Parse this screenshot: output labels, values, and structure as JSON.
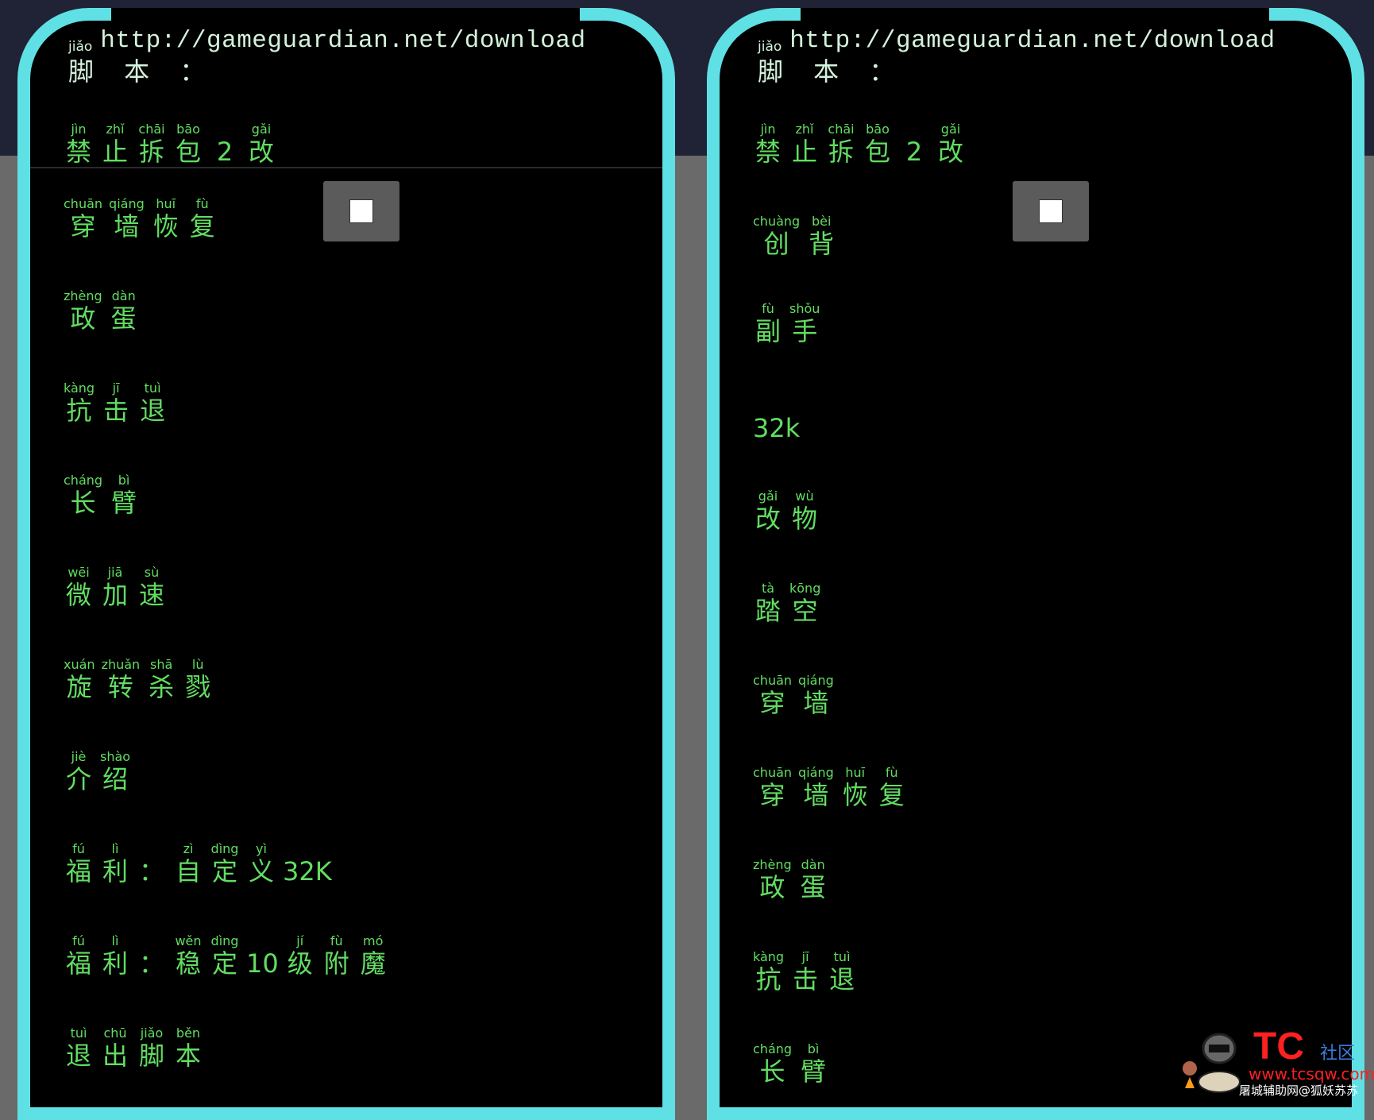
{
  "colors": {
    "accent_cyan": "#5fe0e4",
    "menu_text": "#62dd62",
    "header_text": "#d4f2dc",
    "top_bg": "#1f2335",
    "bottom_bg": "#6a6a6a"
  },
  "panels": [
    {
      "header": {
        "pinyin": "jiǎo",
        "url": "http://gameguardian.net/download",
        "title": "脚 本 ："
      },
      "toggle_checked": false,
      "items": [
        [
          {
            "py": "jìn",
            "ch": "禁"
          },
          {
            "py": "zhǐ",
            "ch": "止"
          },
          {
            "py": "chāi",
            "ch": "拆"
          },
          {
            "py": "bāo",
            "ch": "包"
          },
          {
            "py": "",
            "ch": "2"
          },
          {
            "py": "gǎi",
            "ch": "改"
          }
        ],
        [
          {
            "py": "chuān",
            "ch": "穿"
          },
          {
            "py": "qiáng",
            "ch": "墙"
          },
          {
            "py": "huī",
            "ch": "恢"
          },
          {
            "py": "fù",
            "ch": "复"
          }
        ],
        [
          {
            "py": "zhèng",
            "ch": "政"
          },
          {
            "py": "dàn",
            "ch": "蛋"
          }
        ],
        [
          {
            "py": "kàng",
            "ch": "抗"
          },
          {
            "py": "jī",
            "ch": "击"
          },
          {
            "py": "tuì",
            "ch": "退"
          }
        ],
        [
          {
            "py": "cháng",
            "ch": "长"
          },
          {
            "py": "bì",
            "ch": "臂"
          }
        ],
        [
          {
            "py": "wēi",
            "ch": "微"
          },
          {
            "py": "jiā",
            "ch": "加"
          },
          {
            "py": "sù",
            "ch": "速"
          }
        ],
        [
          {
            "py": "xuán",
            "ch": "旋"
          },
          {
            "py": "zhuǎn",
            "ch": "转"
          },
          {
            "py": "shā",
            "ch": "杀"
          },
          {
            "py": "lù",
            "ch": "戮"
          }
        ],
        [
          {
            "py": "jiè",
            "ch": "介"
          },
          {
            "py": "shào",
            "ch": "绍"
          }
        ],
        [
          {
            "py": "fú",
            "ch": "福"
          },
          {
            "py": "lì",
            "ch": "利"
          },
          {
            "py": "",
            "ch": "："
          },
          {
            "py": "zì",
            "ch": "自"
          },
          {
            "py": "dìng",
            "ch": "定"
          },
          {
            "py": "yì",
            "ch": "义"
          },
          {
            "py": "",
            "ch": "32K"
          }
        ],
        [
          {
            "py": "fú",
            "ch": "福"
          },
          {
            "py": "lì",
            "ch": "利"
          },
          {
            "py": "",
            "ch": "："
          },
          {
            "py": "wěn",
            "ch": "稳"
          },
          {
            "py": "dìng",
            "ch": "定"
          },
          {
            "py": "",
            "ch": "10"
          },
          {
            "py": "jí",
            "ch": "级"
          },
          {
            "py": "fù",
            "ch": "附"
          },
          {
            "py": "mó",
            "ch": "魔"
          }
        ],
        [
          {
            "py": "tuì",
            "ch": "退"
          },
          {
            "py": "chū",
            "ch": "出"
          },
          {
            "py": "jiǎo",
            "ch": "脚"
          },
          {
            "py": "běn",
            "ch": "本"
          }
        ]
      ]
    },
    {
      "header": {
        "pinyin": "jiǎo",
        "url": "http://gameguardian.net/download",
        "title": "脚 本 ："
      },
      "toggle_checked": false,
      "items": [
        [
          {
            "py": "jìn",
            "ch": "禁"
          },
          {
            "py": "zhǐ",
            "ch": "止"
          },
          {
            "py": "chāi",
            "ch": "拆"
          },
          {
            "py": "bāo",
            "ch": "包"
          },
          {
            "py": "",
            "ch": "2"
          },
          {
            "py": "gǎi",
            "ch": "改"
          }
        ],
        [
          {
            "py": "chuàng",
            "ch": "创"
          },
          {
            "py": "bèi",
            "ch": "背"
          }
        ],
        [
          {
            "py": "fù",
            "ch": "副"
          },
          {
            "py": "shǒu",
            "ch": "手"
          }
        ],
        [
          {
            "py": "",
            "ch": "32k"
          }
        ],
        [
          {
            "py": "gǎi",
            "ch": "改"
          },
          {
            "py": "wù",
            "ch": "物"
          }
        ],
        [
          {
            "py": "tà",
            "ch": "踏"
          },
          {
            "py": "kōng",
            "ch": "空"
          }
        ],
        [
          {
            "py": "chuān",
            "ch": "穿"
          },
          {
            "py": "qiáng",
            "ch": "墙"
          }
        ],
        [
          {
            "py": "chuān",
            "ch": "穿"
          },
          {
            "py": "qiáng",
            "ch": "墙"
          },
          {
            "py": "huī",
            "ch": "恢"
          },
          {
            "py": "fù",
            "ch": "复"
          }
        ],
        [
          {
            "py": "zhèng",
            "ch": "政"
          },
          {
            "py": "dàn",
            "ch": "蛋"
          }
        ],
        [
          {
            "py": "kàng",
            "ch": "抗"
          },
          {
            "py": "jī",
            "ch": "击"
          },
          {
            "py": "tuì",
            "ch": "退"
          }
        ],
        [
          {
            "py": "cháng",
            "ch": "长"
          },
          {
            "py": "bì",
            "ch": "臂"
          }
        ]
      ]
    }
  ],
  "watermark": {
    "logo": "TC",
    "community": "社区",
    "url": "www.tcsqw.com",
    "byline": "屠城辅助网@狐妖苏苏"
  }
}
